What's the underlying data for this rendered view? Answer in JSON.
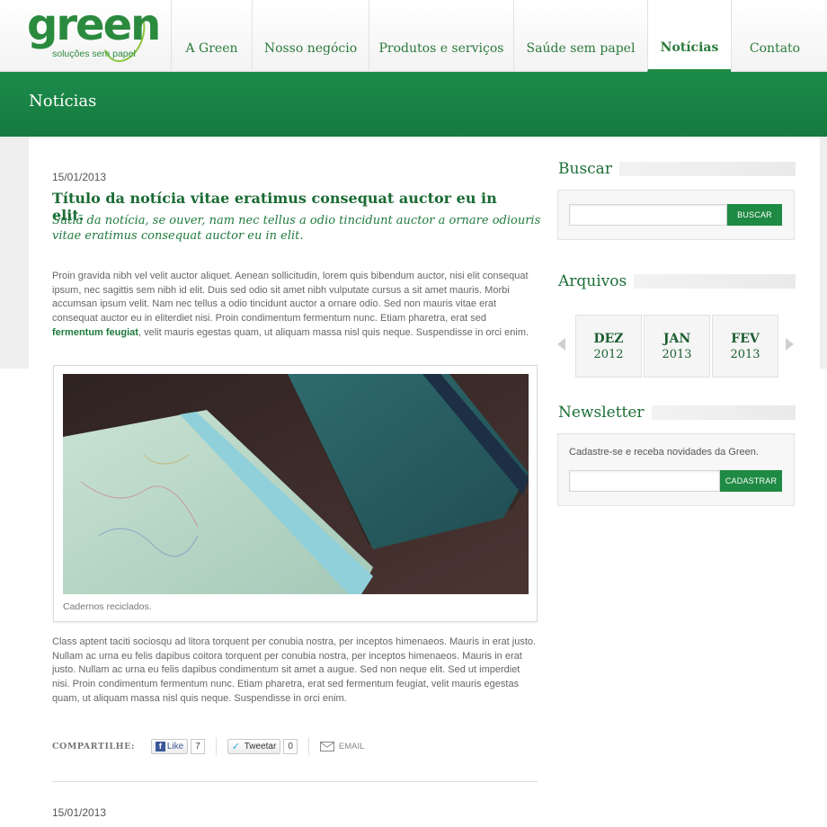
{
  "logo": {
    "word": "green",
    "tagline": "soluções sem papel"
  },
  "nav": {
    "items": [
      {
        "label": "A Green"
      },
      {
        "label": "Nosso negócio"
      },
      {
        "label": "Produtos e serviços"
      },
      {
        "label": "Saúde sem papel"
      },
      {
        "label": "Notícias",
        "active": true
      },
      {
        "label": "Contato"
      }
    ]
  },
  "page_title": "Notícias",
  "article": {
    "date": "15/01/2013",
    "title": "Título da notícia vitae eratimus consequat auctor eu in elit.",
    "subtitle": "Sutiã da notícia, se ouver, nam nec tellus a odio tincidunt auctor a ornare odiouris vitae eratimus consequat auctor eu in elit.",
    "para1_before": "Proin gravida nibh vel velit auctor aliquet. Aenean sollicitudin, lorem quis bibendum auctor, nisi elit consequat ipsum, nec sagittis sem nibh id elit. Duis sed odio sit amet nibh vulputate cursus a sit amet mauris. Morbi accumsan ipsum velit. Nam nec tellus a odio tincidunt auctor a ornare odio. Sed non mauris vitae erat consequat auctor eu in eliterdiet nisi. Proin condimentum fermentum nunc. Etiam pharetra, erat sed ",
    "para1_link": "fermentum feugiat",
    "para1_after": ", velit mauris egestas quam, ut aliquam massa nisl quis neque. Suspendisse in orci enim.",
    "caption": "Cadernos reciclados.",
    "para2": "Class aptent taciti sociosqu ad litora torquent per conubia nostra, per inceptos himenaeos. Mauris in erat justo. Nullam ac urna eu felis dapibus coitora torquent per conubia nostra, per inceptos himenaeos. Mauris in erat justo. Nullam ac urna eu felis dapibus condimentum sit amet a augue. Sed non neque elit. Sed ut imperdiet nisi. Proin condimentum fermentum nunc. Etiam pharetra, erat sed fermentum feugiat, velit mauris egestas quam, ut aliquam massa nisl quis neque. Suspendisse in orci enim.",
    "share": {
      "label": "COMPARTILHE:",
      "like_label": "Like",
      "like_count": "7",
      "tweet_label": "Tweetar",
      "tweet_count": "0",
      "email_label": "EMAIL"
    },
    "next_date": "15/01/2013"
  },
  "sidebar": {
    "search": {
      "heading": "Buscar",
      "button": "BUSCAR",
      "value": ""
    },
    "archives": {
      "heading": "Arquivos",
      "items": [
        {
          "month": "DEZ",
          "year": "2012"
        },
        {
          "month": "JAN",
          "year": "2013"
        },
        {
          "month": "FEV",
          "year": "2013"
        }
      ]
    },
    "newsletter": {
      "heading": "Newsletter",
      "text": "Cadastre-se e receba novidades da Green.",
      "button": "CADASTRAR",
      "value": ""
    }
  },
  "colors": {
    "brand_green": "#1f8a43",
    "heading_green": "#1b6e36"
  }
}
